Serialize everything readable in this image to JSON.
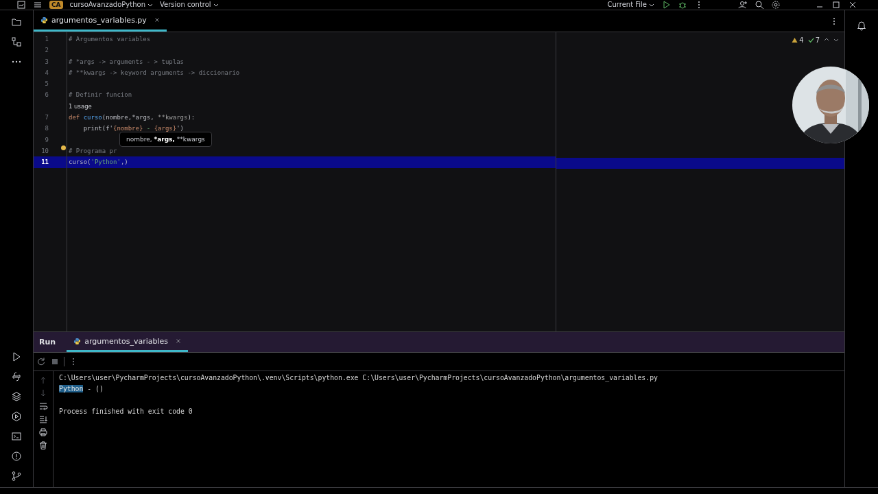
{
  "title_bar": {
    "project_badge": "CA",
    "project": "cursoAvanzadoPython",
    "vcs": "Version control",
    "run_config": "Current File"
  },
  "editor_tabs": [
    {
      "label": "argumentos_variables.py",
      "selected": true
    }
  ],
  "inspections": {
    "warnings": "4",
    "checks": "7"
  },
  "editor": {
    "lines": [
      {
        "number": "1",
        "selected": false,
        "segments": [
          {
            "text": "# Argumentos variables",
            "kind": "comment"
          }
        ]
      },
      {
        "number": "2",
        "selected": false
      },
      {
        "number": "3",
        "selected": false,
        "segments": [
          {
            "text": "# *args -> arguments - > tuplas",
            "kind": "comment"
          }
        ]
      },
      {
        "number": "4",
        "selected": false,
        "segments": [
          {
            "text": "# **kwargs -> keyword arguments -> diccionario",
            "kind": "comment"
          }
        ]
      },
      {
        "number": "5",
        "selected": false
      },
      {
        "number": "6",
        "selected": false,
        "segments": [
          {
            "text": "# Definir funcion",
            "kind": "comment"
          }
        ]
      },
      {
        "number": "7",
        "selected": false,
        "hint": "1 usage",
        "segments": [
          {
            "text": "def ",
            "kind": "keyword"
          },
          {
            "text": "curso",
            "kind": "fn"
          },
          {
            "text": "(nombre,*args, ",
            "kind": "plain"
          },
          {
            "text": "**kwargs",
            "kind": "param"
          },
          {
            "text": "):",
            "kind": "plain"
          }
        ]
      },
      {
        "number": "8",
        "selected": false,
        "segments": [
          {
            "text": "    print(f'",
            "kind": "plain"
          },
          {
            "text": "{nombre}",
            "kind": "brace"
          },
          {
            "text": " - ",
            "kind": "string"
          },
          {
            "text": "{args}",
            "kind": "brace"
          },
          {
            "text": "')",
            "kind": "plain"
          }
        ]
      },
      {
        "number": "9",
        "selected": false
      },
      {
        "number": "10",
        "selected": false,
        "segments": [
          {
            "text": "# Programa pr",
            "kind": "comment"
          }
        ]
      },
      {
        "number": "11",
        "selected": true,
        "segments": [
          {
            "text": "curso(",
            "kind": "plain"
          },
          {
            "text": "'Python'",
            "kind": "string"
          },
          {
            "text": ",)",
            "kind": "plain"
          }
        ]
      }
    ]
  },
  "tooltip": {
    "parts": [
      {
        "text": "nombre, ",
        "bold": false
      },
      {
        "text": "*args,",
        "bold": true
      },
      {
        "text": " **kwargs",
        "bold": false
      }
    ]
  },
  "run_panel": {
    "title": "Run",
    "tabs": [
      {
        "label": "argumentos_variables",
        "selected": true
      }
    ],
    "console": [
      {
        "kind": "output",
        "segments": [
          {
            "text": "C:\\Users\\user\\PycharmProjects\\cursoAvanzadoPython\\.venv\\Scripts\\python.exe C:\\Users\\user\\PycharmProjects\\cursoAvanzadoPython\\argumentos_variables.py",
            "highlighted": false
          }
        ]
      },
      {
        "kind": "output",
        "segments": [
          {
            "text": "Python",
            "highlighted": true
          },
          {
            "text": " - ()",
            "highlighted": false
          }
        ]
      },
      {
        "kind": "blank"
      },
      {
        "kind": "output",
        "segments": [
          {
            "text": "Process finished with exit code 0",
            "highlighted": false
          }
        ]
      }
    ]
  }
}
